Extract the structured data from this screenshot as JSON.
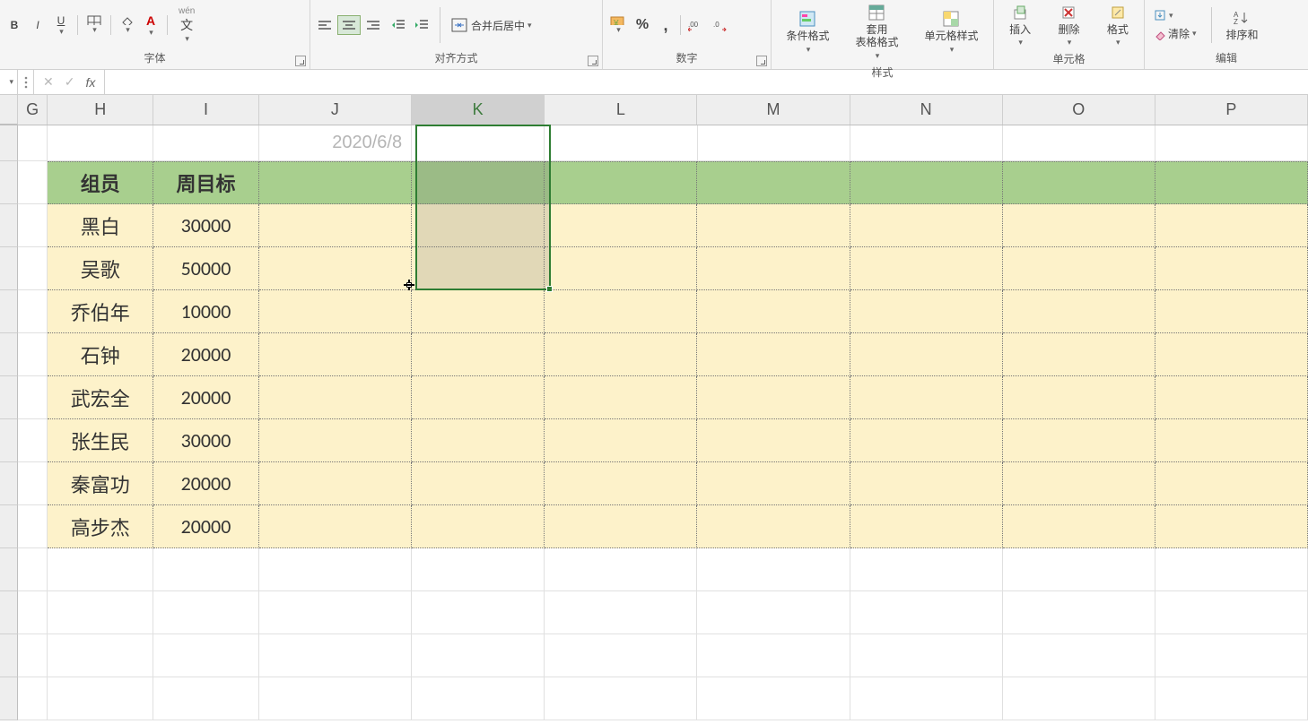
{
  "ribbon": {
    "font": {
      "label": "字体",
      "bold": "B",
      "italic": "I",
      "underline": "U",
      "wen": "wén",
      "wen2": "文"
    },
    "align": {
      "label": "对齐方式",
      "merge_label": "合并后居中"
    },
    "number": {
      "label": "数字",
      "percent": "%",
      "comma": ","
    },
    "styles": {
      "label": "样式",
      "cond_fmt": "条件格式",
      "table_fmt": "套用\n表格格式",
      "cell_style": "单元格样式"
    },
    "cells": {
      "label": "单元格",
      "insert": "插入",
      "delete": "删除",
      "format": "格式"
    },
    "editing": {
      "label": "编辑",
      "clear": "清除",
      "sort": "排序和"
    }
  },
  "formula_bar": {
    "fx": "fx",
    "value": ""
  },
  "columns": [
    "G",
    "H",
    "I",
    "J",
    "K",
    "L",
    "M",
    "N",
    "O",
    "P"
  ],
  "selected_col": "K",
  "sheet": {
    "ghost_date": "2020/6/8",
    "headers": {
      "h": "组员",
      "i": "周目标"
    },
    "rows": [
      {
        "name": "黑白",
        "target": "30000"
      },
      {
        "name": "吴歌",
        "target": "50000"
      },
      {
        "name": "乔伯年",
        "target": "10000"
      },
      {
        "name": "石钟",
        "target": "20000"
      },
      {
        "name": "武宏全",
        "target": "20000"
      },
      {
        "name": "张生民",
        "target": "30000"
      },
      {
        "name": "秦富功",
        "target": "20000"
      },
      {
        "name": "高步杰",
        "target": "20000"
      }
    ]
  }
}
